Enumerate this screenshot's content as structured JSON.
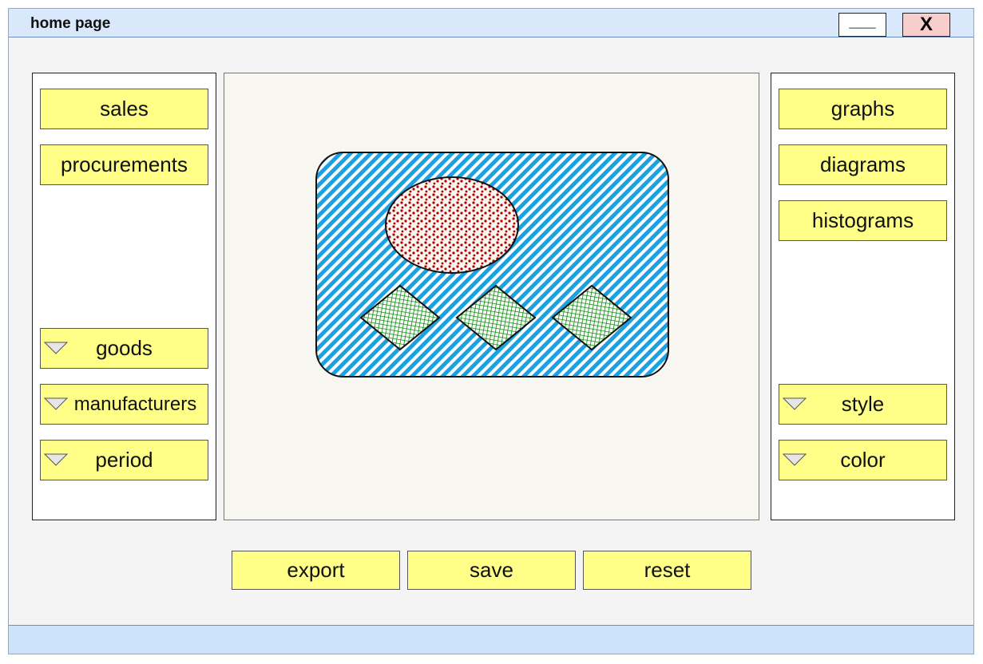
{
  "window": {
    "title": "home page",
    "minimize_label": "___",
    "close_label": "X"
  },
  "left_panel": {
    "buttons": [
      {
        "label": "sales"
      },
      {
        "label": "procurements"
      }
    ],
    "dropdowns": [
      {
        "label": "goods"
      },
      {
        "label": "manufacturers"
      },
      {
        "label": "period"
      }
    ]
  },
  "right_panel": {
    "buttons": [
      {
        "label": "graphs"
      },
      {
        "label": "diagrams"
      },
      {
        "label": "histograms"
      }
    ],
    "dropdowns": [
      {
        "label": "style"
      },
      {
        "label": "color"
      }
    ]
  },
  "actions": [
    {
      "label": "export"
    },
    {
      "label": "save"
    },
    {
      "label": "reset"
    }
  ],
  "colors": {
    "title_bar": "#dae8fc",
    "status_bar": "#cce3fb",
    "button": "#ffff88",
    "close_button": "#f8cecc",
    "canvas": "#f8f6f0",
    "hatch_blue": "#1ba1e2",
    "ellipse_dots": "#b20000",
    "diamond_green": "#008a00"
  },
  "icons": {
    "dropdown": "triangle-down-icon"
  }
}
